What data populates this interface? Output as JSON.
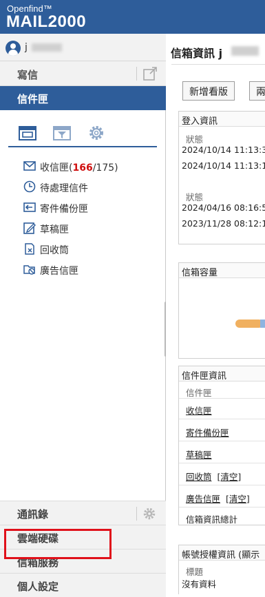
{
  "header": {
    "brand_small": "Openfind™",
    "brand_big": "MAIL2000"
  },
  "user": {
    "name": "j"
  },
  "nav": {
    "compose_label": "寫信",
    "mailbox_label": "信件匣",
    "folders": [
      {
        "label": "收信匣(",
        "unread": "166",
        "total": "/175)",
        "icon": "inbox-icon"
      },
      {
        "label": "待處理信件",
        "icon": "clock-icon"
      },
      {
        "label": "寄件備份匣",
        "icon": "sent-icon"
      },
      {
        "label": "草稿匣",
        "icon": "draft-icon"
      },
      {
        "label": "回收筒",
        "icon": "trash-icon"
      },
      {
        "label": "廣告信匣",
        "icon": "spam-icon"
      }
    ],
    "bottom": [
      {
        "label": "通訊錄",
        "gear": true
      },
      {
        "label": "雲端硬碟"
      },
      {
        "label": "信箱服務"
      },
      {
        "label": "個人設定"
      }
    ]
  },
  "main": {
    "title": "信箱資訊 j",
    "buttons": [
      "新增看版",
      "兩"
    ],
    "login_box": {
      "title": "登入資訊",
      "col_status": "狀態",
      "rows_a": [
        "2024/10/14 11:13:3",
        "2024/10/14 11:13:1"
      ],
      "col_status2": "狀態",
      "rows_b": [
        "2024/04/16 08:16:5",
        "2023/11/28 08:12:1"
      ]
    },
    "quota_box": {
      "title": "信箱容量"
    },
    "folder_box": {
      "title": "信件匣資訊",
      "col_header": "信件匣",
      "rows": [
        "收信匣",
        "寄件備份匣",
        "草稿匣",
        "回收筒",
        "廣告信匣"
      ],
      "clear_label": "[清空]",
      "total_label": "信箱資訊總計"
    },
    "auth_box": {
      "title": "帳號授權資訊 (顯示",
      "col_header": "標題",
      "empty_text": "沒有資料"
    }
  },
  "colors": {
    "brand_blue": "#2e5d9a",
    "unread_red": "#d01010",
    "highlight_red": "#e0101a"
  }
}
